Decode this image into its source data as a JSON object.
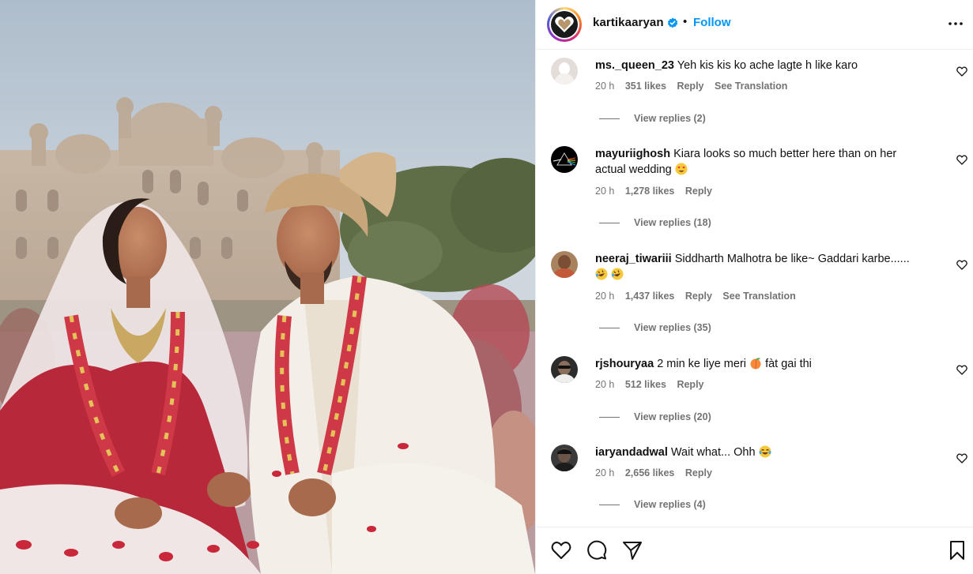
{
  "post": {
    "image_alt": "Wedding photo of a bride and groom seated, smiling at each other"
  },
  "header": {
    "username": "kartikaaryan",
    "separator": "•",
    "follow_label": "Follow"
  },
  "comments": [
    {
      "username": "ms._queen_23",
      "text": "Yeh kis kis ko ache lagte h like karo",
      "time": "20 h",
      "likes": "351 likes",
      "reply_label": "Reply",
      "translate_label": "See Translation",
      "view_replies": "View replies (2)"
    },
    {
      "username": "mayuriighosh",
      "text": "Kiara looks so much better here than on her actual wedding",
      "time": "20 h",
      "likes": "1,278 likes",
      "reply_label": "Reply",
      "translate_label": "",
      "view_replies": "View replies (18)"
    },
    {
      "username": "neeraj_tiwariii",
      "text": "Siddharth Malhotra be like~ Gaddari karbe......",
      "time": "20 h",
      "likes": "1,437 likes",
      "reply_label": "Reply",
      "translate_label": "See Translation",
      "view_replies": "View replies (35)"
    },
    {
      "username": "rjshouryaa",
      "text_a": "2 min ke liye meri",
      "text_b": "fàt gai thi",
      "time": "20 h",
      "likes": "512 likes",
      "reply_label": "Reply",
      "translate_label": "",
      "view_replies": "View replies (20)"
    },
    {
      "username": "iaryandadwal",
      "text": "Wait what... Ohh",
      "time": "20 h",
      "likes": "2,656 likes",
      "reply_label": "Reply",
      "translate_label": "",
      "view_replies": "View replies (4)"
    }
  ],
  "icons": {
    "like": "heart-icon",
    "comment": "comment-icon",
    "share": "share-icon",
    "save": "bookmark-icon",
    "more": "more-options-icon",
    "verified": "verified-badge-icon"
  },
  "colors": {
    "accent": "#0095f6",
    "muted": "#737373",
    "border": "#efefef"
  }
}
